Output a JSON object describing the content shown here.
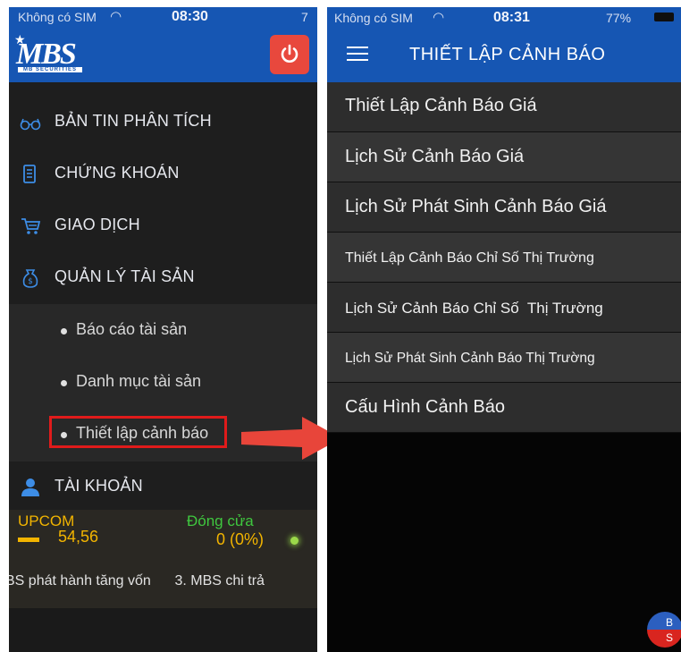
{
  "left_screen": {
    "status_bar": {
      "carrier": "Không có SIM",
      "time": "08:30",
      "battery": "7"
    },
    "header": {
      "logo_text": "MBS",
      "logo_subtext": "MB SECURITIES",
      "power_icon": "power-icon"
    },
    "menu": [
      {
        "label": "BẢN TIN PHÂN TÍCH",
        "icon": "glasses-icon"
      },
      {
        "label": "CHỨNG KHOÁN",
        "icon": "document-icon"
      },
      {
        "label": "GIAO DỊCH",
        "icon": "cart-icon"
      },
      {
        "label": "QUẢN LÝ TÀI SẢN",
        "icon": "money-bag-icon"
      }
    ],
    "submenu": [
      {
        "label": "Báo cáo tài sản"
      },
      {
        "label": "Danh mục tài sản"
      },
      {
        "label": "Thiết lập cảnh báo",
        "highlighted": true
      }
    ],
    "account": {
      "label": "TÀI KHOẢN",
      "icon": "user-icon"
    },
    "ticker": {
      "index_name": "UPCOM",
      "status": "Đóng cửa",
      "value": "54,56",
      "change": "0 (0%)",
      "news": "BS phát hành tăng vốn      3. MBS chi trả"
    }
  },
  "right_screen": {
    "status_bar": {
      "carrier": "Không có SIM",
      "time": "08:31",
      "battery": "77%"
    },
    "header": {
      "title": "THIẾT LẬP CẢNH BÁO",
      "menu_icon": "hamburger-icon"
    },
    "options": [
      {
        "label": "Thiết Lập Cảnh Báo Giá"
      },
      {
        "label": "Lịch Sử Cảnh Báo Giá"
      },
      {
        "label": "Lịch Sử Phát Sinh Cảnh Báo Giá"
      },
      {
        "label": "Thiết Lập Cảnh Báo Chỉ Số Thị Trường"
      },
      {
        "label": "Lịch Sử Cảnh Báo Chỉ Số  Thị Trường"
      },
      {
        "label": "Lịch Sử Phát Sinh Cảnh Báo Thị Trường"
      },
      {
        "label": "Cấu Hình Cảnh Báo"
      }
    ],
    "badge": {
      "top": "B",
      "bottom": "S"
    }
  },
  "colors": {
    "header_blue": "#1656b3",
    "highlight_red": "#e01b1b",
    "arrow_red": "#e8453a",
    "ticker_yellow": "#f2b400",
    "ticker_green": "#3fc73f"
  }
}
